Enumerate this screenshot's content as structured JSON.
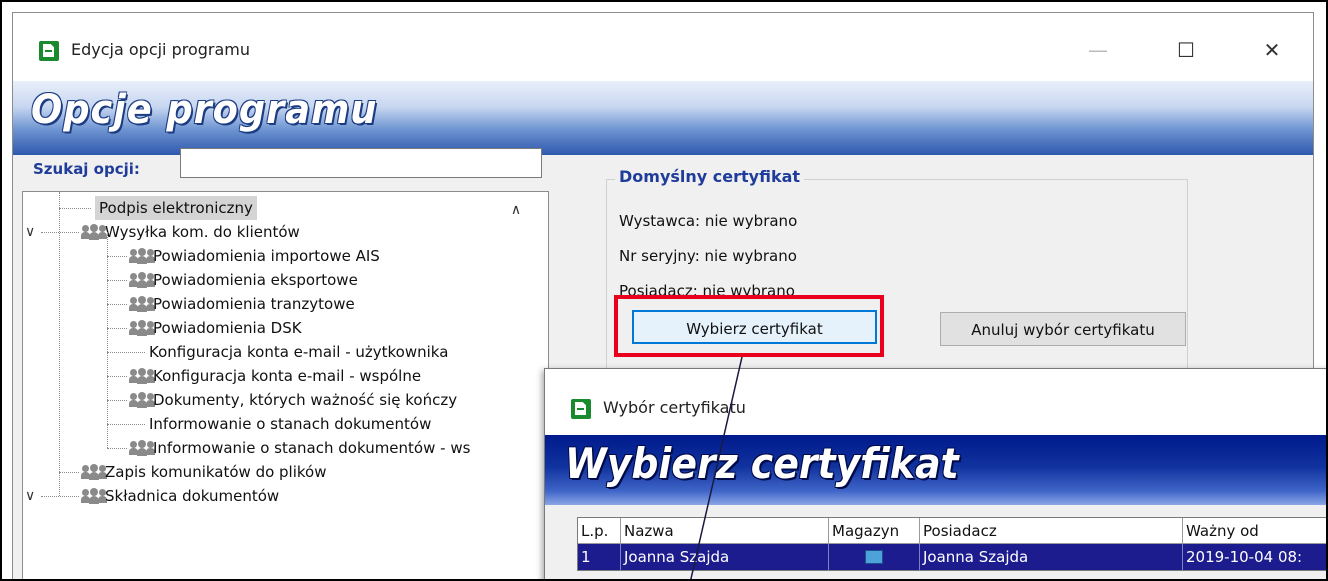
{
  "main_window": {
    "title": "Edycja opcji programu",
    "banner": "Opcje programu",
    "minimize_glyph": "—",
    "maximize_glyph": "☐",
    "close_glyph": "✕"
  },
  "search": {
    "label": "Szukaj opcji:",
    "value": ""
  },
  "tree": {
    "items": [
      {
        "label": "Podpis elektroniczny",
        "icon": "none",
        "selected": true
      },
      {
        "label": "Wysyłka kom. do klientów",
        "icon": "people-icon",
        "expandable": true
      },
      {
        "label": "Powiadomienia importowe AIS",
        "icon": "people-icon"
      },
      {
        "label": "Powiadomienia eksportowe",
        "icon": "people-icon"
      },
      {
        "label": "Powiadomienia tranzytowe",
        "icon": "people-icon"
      },
      {
        "label": "Powiadomienia DSK",
        "icon": "people-icon"
      },
      {
        "label": "Konfiguracja konta e-mail - użytkownika",
        "icon": "none"
      },
      {
        "label": "Konfiguracja konta e-mail - wspólne",
        "icon": "people-icon"
      },
      {
        "label": "Dokumenty, których ważność się kończy",
        "icon": "people-icon"
      },
      {
        "label": "Informowanie o stanach dokumentów",
        "icon": "none"
      },
      {
        "label": "Informowanie o stanach dokumentów - ws",
        "icon": "people-icon"
      },
      {
        "label": "Zapis komunikatów do plików",
        "icon": "people-icon"
      },
      {
        "label": "Składnica dokumentów",
        "icon": "people-icon",
        "expandable": true
      }
    ]
  },
  "certificate": {
    "group_title": "Domyślny certyfikat",
    "issuer": "Wystawca: nie wybrano",
    "serial": "Nr seryjny: nie wybrano",
    "owner": "Posiadacz: nie wybrano",
    "choose_button": "Wybierz certyfikat",
    "cancel_button": "Anuluj wybór certyfikatu"
  },
  "dialog": {
    "title": "Wybór certyfikatu",
    "banner": "Wybierz certyfikat",
    "columns": [
      "L.p.",
      "Nazwa",
      "Magazyn",
      "Posiadacz",
      "Ważny od"
    ],
    "rows": [
      {
        "lp": "1",
        "name": "Joanna Szajda",
        "store_icon": "certificate-store-icon",
        "owner": "Joanna Szajda",
        "valid_from": "2019-10-04 08:"
      }
    ]
  },
  "colors": {
    "highlight": "#e8001c",
    "selection": "#1c1c8e",
    "accent": "#1f3c9a"
  }
}
